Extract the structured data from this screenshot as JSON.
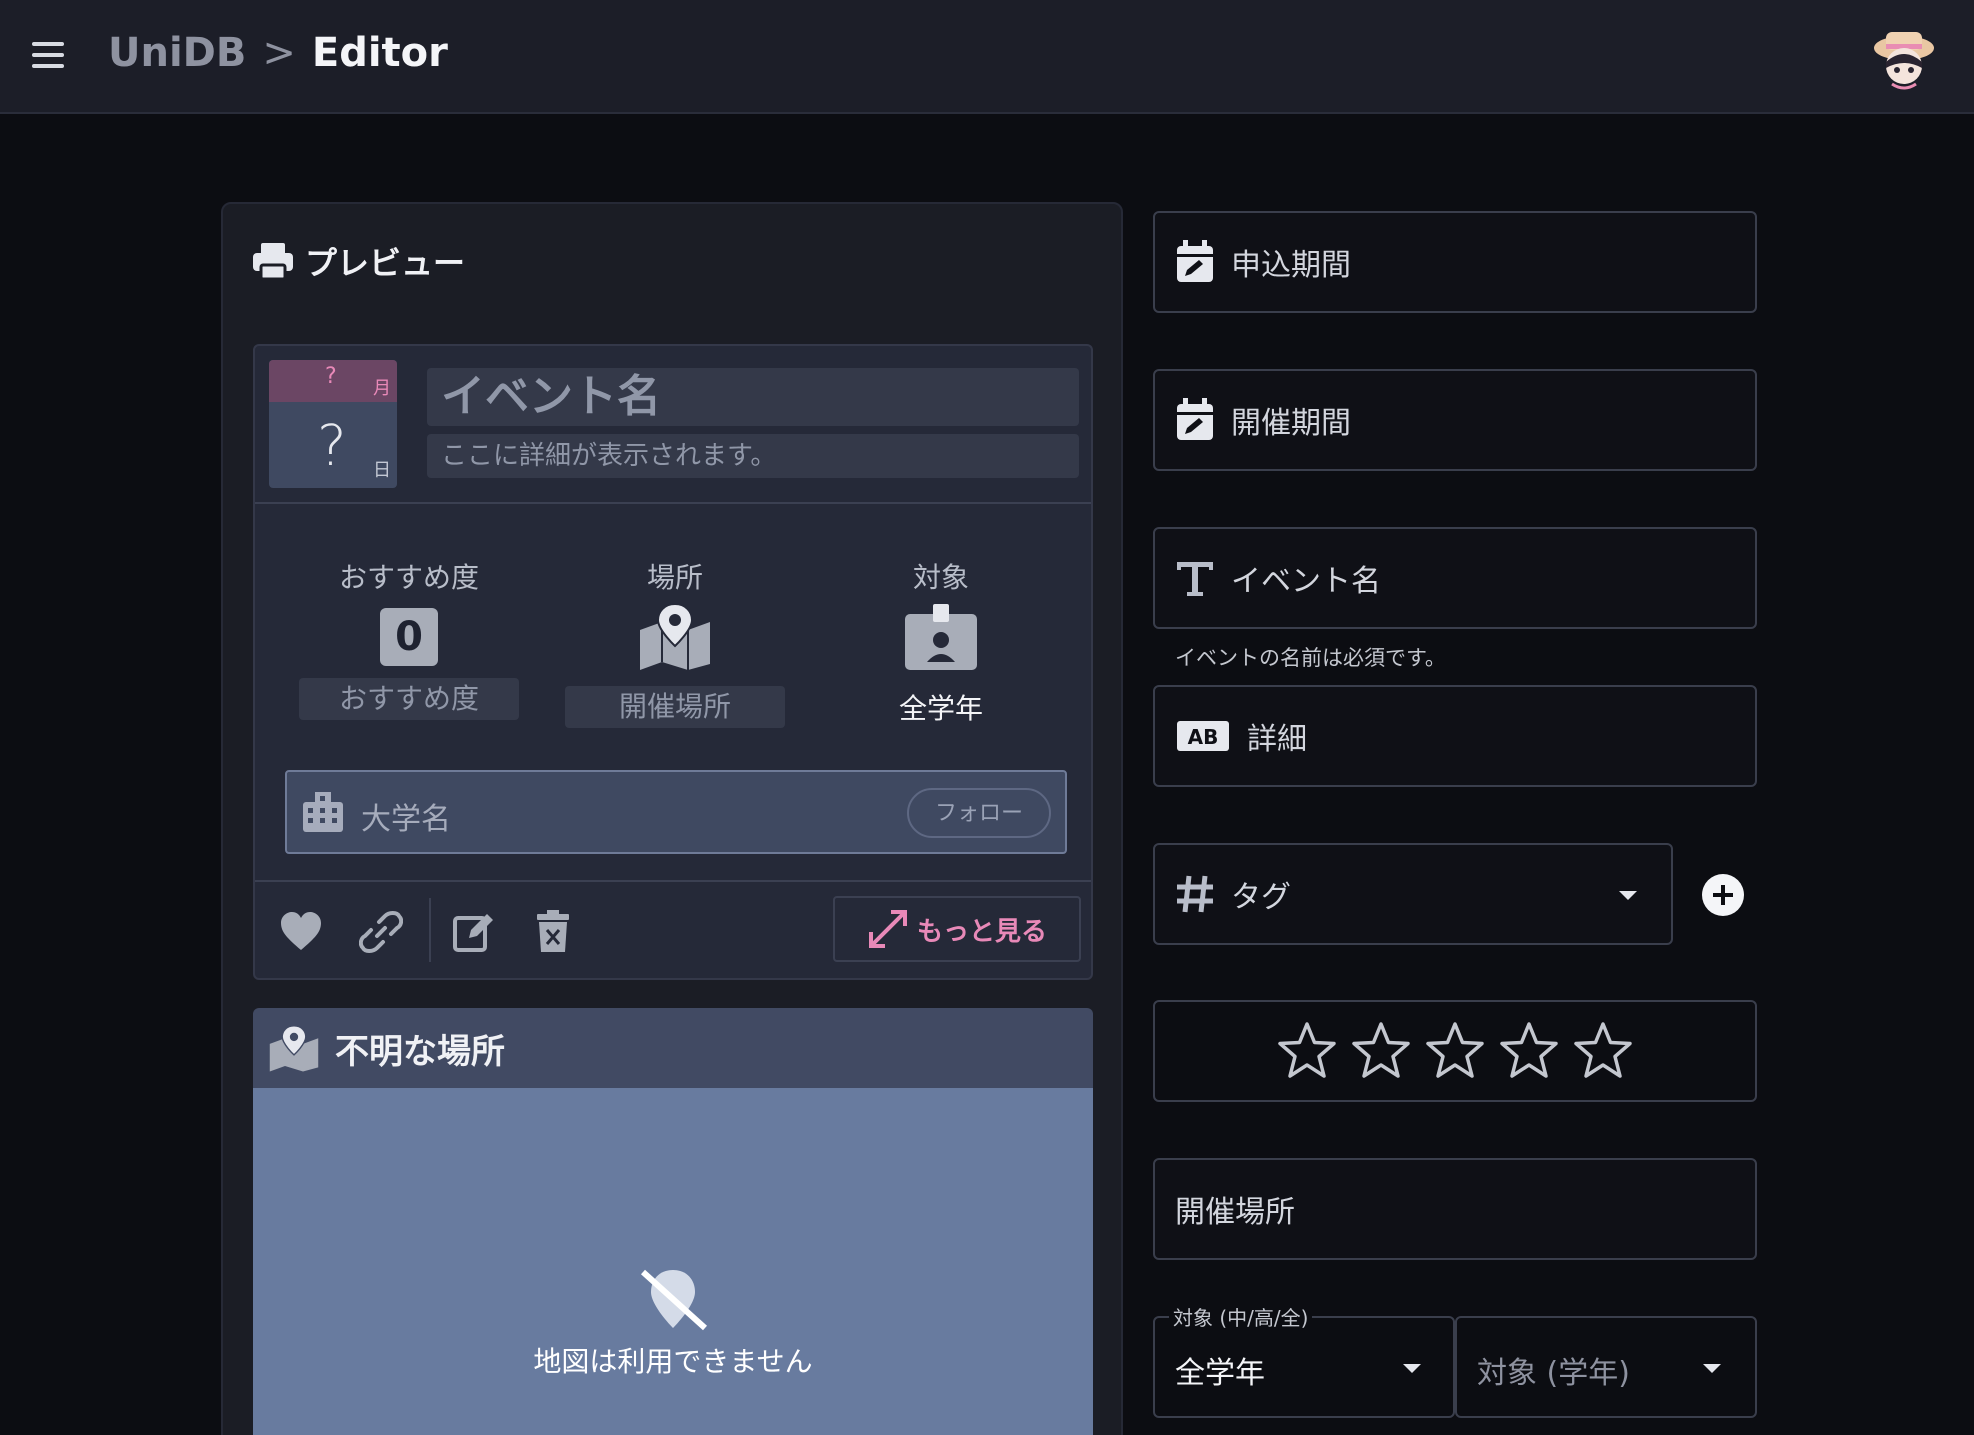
{
  "appbar": {
    "breadcrumb_root": "UniDB",
    "breadcrumb_separator": ">",
    "breadcrumb_current": "Editor"
  },
  "preview": {
    "title": "プレビュー",
    "date": {
      "month_value": "?",
      "month_unit": "月",
      "day_value": "?",
      "day_unit": "日"
    },
    "event_name_placeholder": "イベント名",
    "event_detail_placeholder": "ここに詳細が表示されます。",
    "stats": {
      "recommend_label": "おすすめ度",
      "recommend_value": "0",
      "recommend_chip": "おすすめ度",
      "place_label": "場所",
      "place_chip": "開催場所",
      "target_label": "対象",
      "target_value": "全学年"
    },
    "university_placeholder": "大学名",
    "follow_label": "フォロー",
    "more_label": "もっと見る",
    "map": {
      "title": "不明な場所",
      "unavailable": "地図は利用できません"
    }
  },
  "form": {
    "application_period": "申込期間",
    "event_period": "開催期間",
    "event_name": "イベント名",
    "event_name_hint": "イベントの名前は必須です。",
    "detail": "詳細",
    "detail_icon_text": "AB",
    "tag": "タグ",
    "rating": {
      "value": 0,
      "max": 5
    },
    "venue": "開催場所",
    "target_level_legend": "対象 (中/高/全)",
    "target_level_value": "全学年",
    "target_grade_placeholder": "対象 (学年)"
  },
  "colors": {
    "accent_pink": "#e889b8",
    "card_bg": "#252938",
    "map_bg": "#687b9f"
  },
  "icons": [
    "menu-icon",
    "printer-icon",
    "map-pin-icon",
    "id-badge-icon",
    "building-icon",
    "heart-icon",
    "link-icon",
    "edit-icon",
    "trash-icon",
    "expand-icon",
    "calendar-edit-icon",
    "text-icon",
    "ab-icon",
    "hashtag-icon",
    "plus-icon",
    "star-icon",
    "map-off-icon"
  ]
}
